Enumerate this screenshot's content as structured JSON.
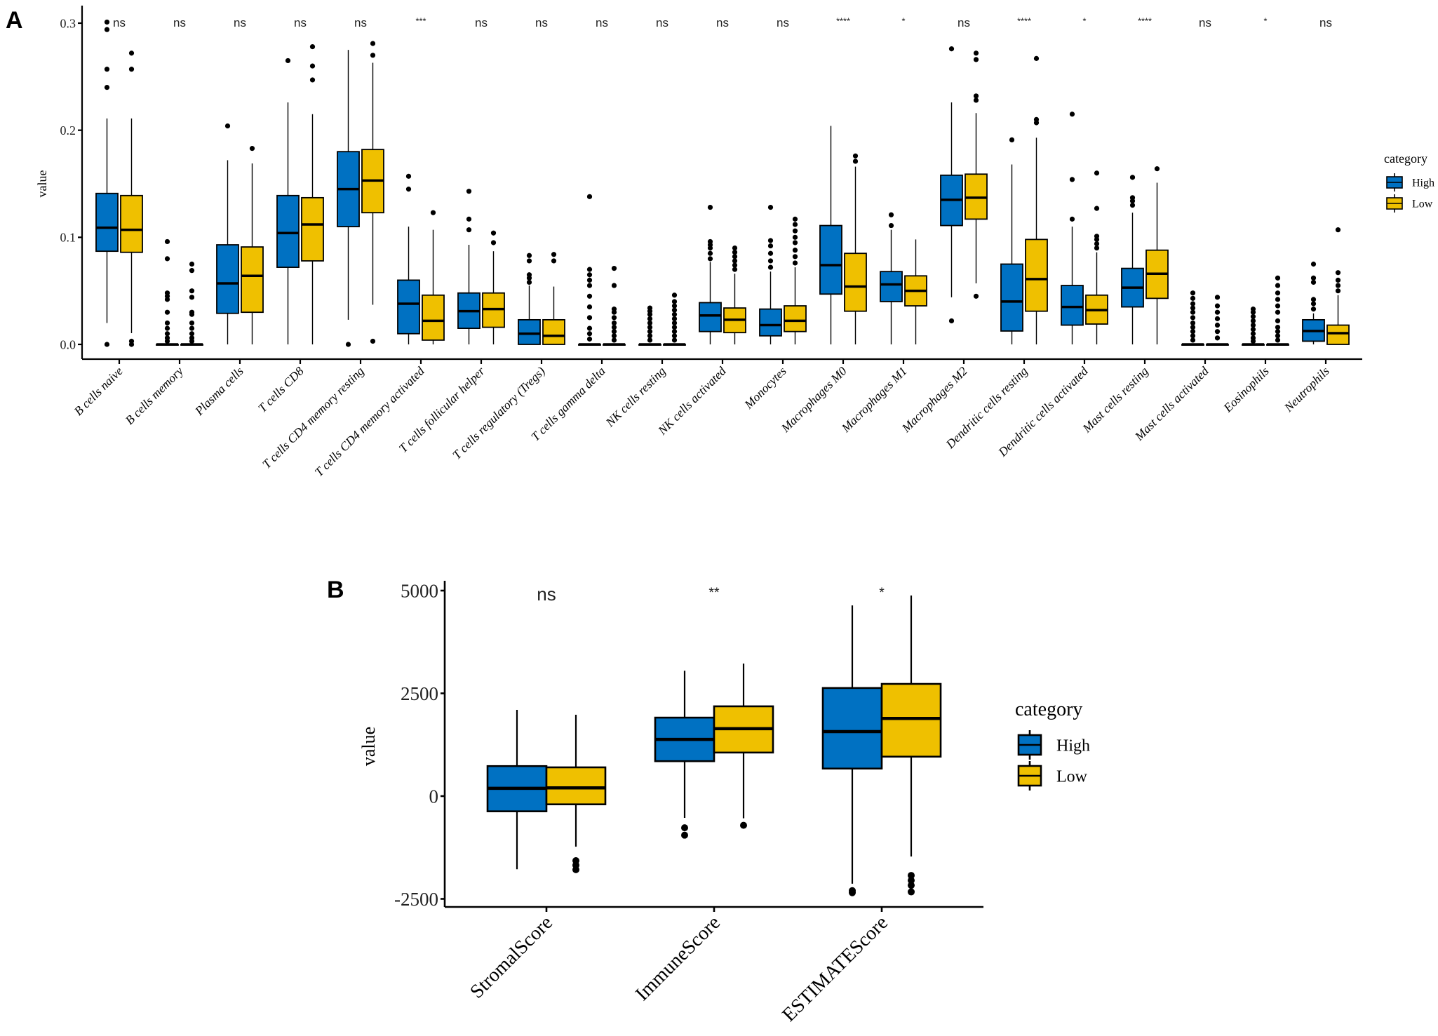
{
  "colors": {
    "high": "#0071C2",
    "low": "#EFC000",
    "stroke": "#000000"
  },
  "chart_data": [
    {
      "panel": "A",
      "type": "boxplot",
      "title": "",
      "xlabel": "",
      "ylabel": "value",
      "ylim": [
        -0.02,
        0.31
      ],
      "yticks": [
        0.0,
        0.1,
        0.2,
        0.3
      ],
      "ytick_labels": [
        "0.0",
        "0.1",
        "0.2",
        "0.3"
      ],
      "legend": {
        "title": "category",
        "entries": [
          "High",
          "Low"
        ],
        "placement": "right"
      },
      "grid": false,
      "categories": [
        "B cells naive",
        "B cells memory",
        "Plasma cells",
        "T cells CD8",
        "T cells CD4 memory resting",
        "T cells CD4 memory activated",
        "T cells follicular helper",
        "T cells regulatory (Tregs)",
        "T cells gamma delta",
        "NK cells resting",
        "NK cells activated",
        "Monocytes",
        "Macrophages M0",
        "Macrophages M1",
        "Macrophages M2",
        "Dendritic cells resting",
        "Dendritic cells activated",
        "Mast cells resting",
        "Mast cells activated",
        "Eosinophils",
        "Neutrophils"
      ],
      "significance": [
        "ns",
        "ns",
        "ns",
        "ns",
        "ns",
        "***",
        "ns",
        "ns",
        "ns",
        "ns",
        "ns",
        "ns",
        "****",
        "*",
        "ns",
        "****",
        "*",
        "****",
        "ns",
        "*",
        "ns"
      ],
      "series": [
        {
          "name": "High",
          "boxes": [
            {
              "min": 0.02,
              "q1": 0.087,
              "median": 0.109,
              "q3": 0.141,
              "max": 0.211,
              "outliers": [
                0.0,
                0.24,
                0.257,
                0.294,
                0.301
              ]
            },
            {
              "min": 0.0,
              "q1": 0.0,
              "median": 0.0,
              "q3": 0.0,
              "max": 0.0,
              "outliers": [
                0.003,
                0.006,
                0.01,
                0.015,
                0.02,
                0.03,
                0.042,
                0.045,
                0.048,
                0.08,
                0.096
              ]
            },
            {
              "min": 0.0,
              "q1": 0.029,
              "median": 0.057,
              "q3": 0.093,
              "max": 0.172,
              "outliers": [
                0.204
              ]
            },
            {
              "min": 0.0,
              "q1": 0.072,
              "median": 0.104,
              "q3": 0.139,
              "max": 0.226,
              "outliers": [
                0.265
              ]
            },
            {
              "min": 0.023,
              "q1": 0.11,
              "median": 0.145,
              "q3": 0.18,
              "max": 0.275,
              "outliers": [
                0.0
              ]
            },
            {
              "min": 0.0,
              "q1": 0.01,
              "median": 0.038,
              "q3": 0.06,
              "max": 0.11,
              "outliers": [
                0.145,
                0.157
              ]
            },
            {
              "min": 0.0,
              "q1": 0.015,
              "median": 0.031,
              "q3": 0.048,
              "max": 0.093,
              "outliers": [
                0.107,
                0.117,
                0.143
              ]
            },
            {
              "min": 0.0,
              "q1": 0.0,
              "median": 0.01,
              "q3": 0.023,
              "max": 0.055,
              "outliers": [
                0.058,
                0.062,
                0.065,
                0.078,
                0.083
              ]
            },
            {
              "min": 0.0,
              "q1": 0.0,
              "median": 0.0,
              "q3": 0.0,
              "max": 0.0,
              "outliers": [
                0.005,
                0.01,
                0.015,
                0.025,
                0.035,
                0.045,
                0.055,
                0.06,
                0.065,
                0.07,
                0.138
              ]
            },
            {
              "min": 0.0,
              "q1": 0.0,
              "median": 0.0,
              "q3": 0.0,
              "max": 0.0,
              "outliers": [
                0.004,
                0.008,
                0.012,
                0.016,
                0.02,
                0.024,
                0.028,
                0.031,
                0.034
              ]
            },
            {
              "min": 0.0,
              "q1": 0.012,
              "median": 0.027,
              "q3": 0.039,
              "max": 0.077,
              "outliers": [
                0.08,
                0.085,
                0.09,
                0.093,
                0.096,
                0.128
              ]
            },
            {
              "min": 0.0,
              "q1": 0.008,
              "median": 0.018,
              "q3": 0.033,
              "max": 0.068,
              "outliers": [
                0.072,
                0.078,
                0.085,
                0.092,
                0.097,
                0.128
              ]
            },
            {
              "min": 0.0,
              "q1": 0.047,
              "median": 0.074,
              "q3": 0.111,
              "max": 0.204,
              "outliers": []
            },
            {
              "min": 0.0,
              "q1": 0.04,
              "median": 0.056,
              "q3": 0.068,
              "max": 0.107,
              "outliers": [
                0.111,
                0.121
              ]
            },
            {
              "min": 0.044,
              "q1": 0.111,
              "median": 0.135,
              "q3": 0.158,
              "max": 0.226,
              "outliers": [
                0.022,
                0.276
              ]
            },
            {
              "min": 0.0,
              "q1": 0.0125,
              "median": 0.04,
              "q3": 0.075,
              "max": 0.168,
              "outliers": [
                0.191
              ]
            },
            {
              "min": 0.0,
              "q1": 0.018,
              "median": 0.035,
              "q3": 0.055,
              "max": 0.11,
              "outliers": [
                0.117,
                0.154,
                0.215
              ]
            },
            {
              "min": 0.0,
              "q1": 0.035,
              "median": 0.053,
              "q3": 0.071,
              "max": 0.123,
              "outliers": [
                0.13,
                0.134,
                0.137,
                0.156
              ]
            },
            {
              "min": 0.0,
              "q1": 0.0,
              "median": 0.0,
              "q3": 0.0,
              "max": 0.0,
              "outliers": [
                0.004,
                0.008,
                0.012,
                0.016,
                0.02,
                0.025,
                0.03,
                0.034,
                0.038,
                0.043,
                0.048
              ]
            },
            {
              "min": 0.0,
              "q1": 0.0,
              "median": 0.0,
              "q3": 0.0,
              "max": 0.0,
              "outliers": [
                0.003,
                0.006,
                0.01,
                0.014,
                0.018,
                0.022,
                0.026,
                0.03,
                0.033
              ]
            },
            {
              "min": 0.0,
              "q1": 0.003,
              "median": 0.0125,
              "q3": 0.023,
              "max": 0.029,
              "outliers": [
                0.033,
                0.038,
                0.042,
                0.058,
                0.062,
                0.075
              ]
            }
          ]
        },
        {
          "name": "Low",
          "boxes": [
            {
              "min": 0.0105,
              "q1": 0.086,
              "median": 0.107,
              "q3": 0.139,
              "max": 0.211,
              "outliers": [
                0.0,
                0.003,
                0.257,
                0.272
              ]
            },
            {
              "min": 0.0,
              "q1": 0.0,
              "median": 0.0,
              "q3": 0.0,
              "max": 0.0,
              "outliers": [
                0.003,
                0.006,
                0.01,
                0.015,
                0.02,
                0.028,
                0.03,
                0.044,
                0.05,
                0.069,
                0.075
              ]
            },
            {
              "min": 0.0,
              "q1": 0.03,
              "median": 0.064,
              "q3": 0.091,
              "max": 0.169,
              "outliers": [
                0.183
              ]
            },
            {
              "min": 0.0,
              "q1": 0.078,
              "median": 0.112,
              "q3": 0.137,
              "max": 0.215,
              "outliers": [
                0.247,
                0.26,
                0.278
              ]
            },
            {
              "min": 0.037,
              "q1": 0.123,
              "median": 0.153,
              "q3": 0.182,
              "max": 0.263,
              "outliers": [
                0.003,
                0.27,
                0.281
              ]
            },
            {
              "min": 0.0,
              "q1": 0.004,
              "median": 0.022,
              "q3": 0.046,
              "max": 0.107,
              "outliers": [
                0.123
              ]
            },
            {
              "min": 0.0,
              "q1": 0.016,
              "median": 0.033,
              "q3": 0.048,
              "max": 0.087,
              "outliers": [
                0.095,
                0.104
              ]
            },
            {
              "min": 0.0,
              "q1": 0.0,
              "median": 0.008,
              "q3": 0.023,
              "max": 0.054,
              "outliers": [
                0.078,
                0.084
              ]
            },
            {
              "min": 0.0,
              "q1": 0.0,
              "median": 0.0,
              "q3": 0.0,
              "max": 0.0,
              "outliers": [
                0.004,
                0.008,
                0.012,
                0.016,
                0.02,
                0.025,
                0.03,
                0.033,
                0.055,
                0.071
              ]
            },
            {
              "min": 0.0,
              "q1": 0.0,
              "median": 0.0,
              "q3": 0.0,
              "max": 0.0,
              "outliers": [
                0.004,
                0.008,
                0.012,
                0.016,
                0.02,
                0.024,
                0.028,
                0.032,
                0.036,
                0.04,
                0.046
              ]
            },
            {
              "min": 0.0,
              "q1": 0.011,
              "median": 0.023,
              "q3": 0.034,
              "max": 0.066,
              "outliers": [
                0.07,
                0.074,
                0.078,
                0.082,
                0.086,
                0.09
              ]
            },
            {
              "min": 0.0,
              "q1": 0.012,
              "median": 0.022,
              "q3": 0.036,
              "max": 0.072,
              "outliers": [
                0.076,
                0.082,
                0.088,
                0.095,
                0.1,
                0.106,
                0.112,
                0.117
              ]
            },
            {
              "min": 0.0,
              "q1": 0.031,
              "median": 0.054,
              "q3": 0.085,
              "max": 0.166,
              "outliers": [
                0.171,
                0.176
              ]
            },
            {
              "min": 0.0,
              "q1": 0.036,
              "median": 0.05,
              "q3": 0.064,
              "max": 0.098,
              "outliers": []
            },
            {
              "min": 0.057,
              "q1": 0.117,
              "median": 0.137,
              "q3": 0.159,
              "max": 0.216,
              "outliers": [
                0.045,
                0.228,
                0.232,
                0.266,
                0.272
              ]
            },
            {
              "min": 0.0,
              "q1": 0.031,
              "median": 0.061,
              "q3": 0.098,
              "max": 0.193,
              "outliers": [
                0.207,
                0.21,
                0.267
              ]
            },
            {
              "min": 0.0,
              "q1": 0.019,
              "median": 0.032,
              "q3": 0.046,
              "max": 0.086,
              "outliers": [
                0.09,
                0.094,
                0.098,
                0.101,
                0.127,
                0.16
              ]
            },
            {
              "min": 0.0,
              "q1": 0.043,
              "median": 0.066,
              "q3": 0.088,
              "max": 0.151,
              "outliers": [
                0.164
              ]
            },
            {
              "min": 0.0,
              "q1": 0.0,
              "median": 0.0,
              "q3": 0.0,
              "max": 0.0,
              "outliers": [
                0.006,
                0.012,
                0.018,
                0.024,
                0.03,
                0.036,
                0.044
              ]
            },
            {
              "min": 0.0,
              "q1": 0.0,
              "median": 0.0,
              "q3": 0.0,
              "max": 0.0,
              "outliers": [
                0.004,
                0.008,
                0.012,
                0.016,
                0.022,
                0.03,
                0.036,
                0.042,
                0.048,
                0.055,
                0.062
              ]
            },
            {
              "min": 0.0,
              "q1": 0.0,
              "median": 0.0105,
              "q3": 0.018,
              "max": 0.046,
              "outliers": [
                0.05,
                0.055,
                0.06,
                0.067,
                0.107
              ]
            }
          ]
        }
      ]
    },
    {
      "panel": "B",
      "type": "boxplot",
      "title": "",
      "xlabel": "",
      "ylabel": "value",
      "ylim": [
        -2700,
        5150
      ],
      "yticks": [
        -2500,
        0,
        2500,
        5000
      ],
      "ytick_labels": [
        "-2500",
        "0",
        "2500",
        "5000"
      ],
      "legend": {
        "title": "category",
        "entries": [
          "High",
          "Low"
        ],
        "placement": "right"
      },
      "grid": false,
      "categories": [
        "StromalScore",
        "ImmuneScore",
        "ESTIMATEScore"
      ],
      "significance": [
        "ns",
        "**",
        "*"
      ],
      "series": [
        {
          "name": "High",
          "boxes": [
            {
              "min": -1780,
              "q1": -370,
              "median": 190,
              "q3": 730,
              "max": 2100,
              "outliers": []
            },
            {
              "min": -530,
              "q1": 850,
              "median": 1380,
              "q3": 1910,
              "max": 3050,
              "outliers": [
                -770,
                -950
              ]
            },
            {
              "min": -2130,
              "q1": 670,
              "median": 1570,
              "q3": 2630,
              "max": 4640,
              "outliers": [
                -2300,
                -2350
              ]
            }
          ]
        },
        {
          "name": "Low",
          "boxes": [
            {
              "min": -1230,
              "q1": -200,
              "median": 200,
              "q3": 700,
              "max": 1980,
              "outliers": [
                -1570,
                -1680,
                -1790
              ]
            },
            {
              "min": -540,
              "q1": 1060,
              "median": 1640,
              "q3": 2185,
              "max": 3225,
              "outliers": [
                -710
              ]
            },
            {
              "min": -1470,
              "q1": 960,
              "median": 1890,
              "q3": 2730,
              "max": 4880,
              "outliers": [
                -1930,
                -2050,
                -2170,
                -2330
              ]
            }
          ]
        }
      ]
    }
  ]
}
